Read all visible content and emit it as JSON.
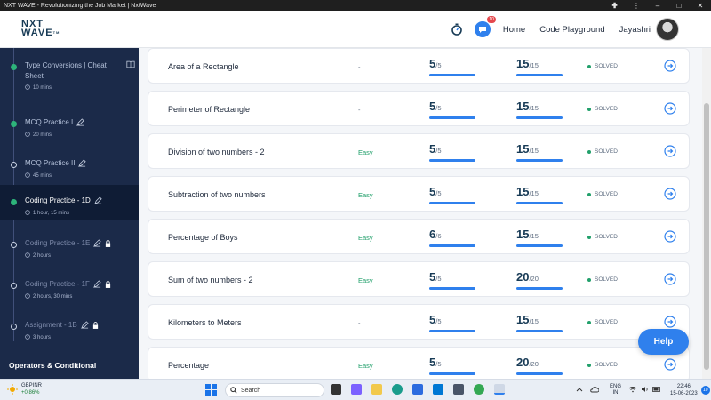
{
  "window": {
    "title": "NXT WAVE - Revolutionizing the Job Market | NxtWave",
    "controls": {
      "minimize": "–",
      "maximize": "□",
      "close": "✕",
      "menu": "⋮"
    }
  },
  "header": {
    "logo_line1": "NXT",
    "logo_line2": "WAVE",
    "logo_tm": "TM",
    "chat_badge": "10",
    "nav": {
      "home": "Home",
      "code_playground": "Code Playground"
    },
    "user_name": "Jayashri"
  },
  "sidebar": {
    "items": [
      {
        "title": "Type Conversions | Cheat Sheet",
        "duration": "10 mins",
        "status": "done",
        "icon": "book-icon"
      },
      {
        "title": "MCQ Practice I",
        "duration": "20 mins",
        "status": "done",
        "icon": "pencil-icon"
      },
      {
        "title": "MCQ Practice II",
        "duration": "45 mins",
        "status": "open",
        "icon": "pencil-icon"
      },
      {
        "title": "Coding Practice - 1D",
        "duration": "1 hour, 15 mins",
        "status": "done",
        "icon": "pencil-icon",
        "active": true
      },
      {
        "title": "Coding Practice - 1E",
        "duration": "2 hours",
        "status": "locked",
        "icon": "pencil-icon"
      },
      {
        "title": "Coding Practice - 1F",
        "duration": "2 hours, 30 mins",
        "status": "locked",
        "icon": "pencil-icon"
      },
      {
        "title": "Assignment - 1B",
        "duration": "3 hours",
        "status": "locked",
        "icon": "pencil-icon"
      }
    ],
    "section_title": "Operators & Conditional"
  },
  "questions": [
    {
      "name": "Area of a Rectangle",
      "difficulty": "-",
      "score": "5",
      "score_max": "/5",
      "score_fraction": 1,
      "points": "15",
      "points_max": "/15",
      "points_fraction": 1,
      "status": "SOLVED"
    },
    {
      "name": "Perimeter of Rectangle",
      "difficulty": "-",
      "score": "5",
      "score_max": "/5",
      "score_fraction": 1,
      "points": "15",
      "points_max": "/15",
      "points_fraction": 1,
      "status": "SOLVED"
    },
    {
      "name": "Division of two numbers - 2",
      "difficulty": "Easy",
      "score": "5",
      "score_max": "/5",
      "score_fraction": 1,
      "points": "15",
      "points_max": "/15",
      "points_fraction": 1,
      "status": "SOLVED"
    },
    {
      "name": "Subtraction of two numbers",
      "difficulty": "Easy",
      "score": "5",
      "score_max": "/5",
      "score_fraction": 1,
      "points": "15",
      "points_max": "/15",
      "points_fraction": 1,
      "status": "SOLVED"
    },
    {
      "name": "Percentage of Boys",
      "difficulty": "Easy",
      "score": "6",
      "score_max": "/6",
      "score_fraction": 1,
      "points": "15",
      "points_max": "/15",
      "points_fraction": 1,
      "status": "SOLVED"
    },
    {
      "name": "Sum of two numbers - 2",
      "difficulty": "Easy",
      "score": "5",
      "score_max": "/5",
      "score_fraction": 1,
      "points": "20",
      "points_max": "/20",
      "points_fraction": 1,
      "status": "SOLVED"
    },
    {
      "name": "Kilometers to Meters",
      "difficulty": "-",
      "score": "5",
      "score_max": "/5",
      "score_fraction": 1,
      "points": "15",
      "points_max": "/15",
      "points_fraction": 1,
      "status": "SOLVED"
    },
    {
      "name": "Percentage",
      "difficulty": "Easy",
      "score": "5",
      "score_max": "/5",
      "score_fraction": 1,
      "points": "20",
      "points_max": "/20",
      "points_fraction": 1,
      "status": "SOLVED"
    }
  ],
  "help_label": "Help",
  "taskbar": {
    "widget_name": "GBPINR",
    "widget_change": "+0.86%",
    "search_label": "Search",
    "lang_line1": "ENG",
    "lang_line2": "IN",
    "time": "22:46",
    "date": "15-06-2023",
    "notification_count": "10"
  },
  "colors": {
    "accent": "#2f80ed",
    "sidebar_bg": "#1b2a49",
    "solved": "#22a06b"
  }
}
